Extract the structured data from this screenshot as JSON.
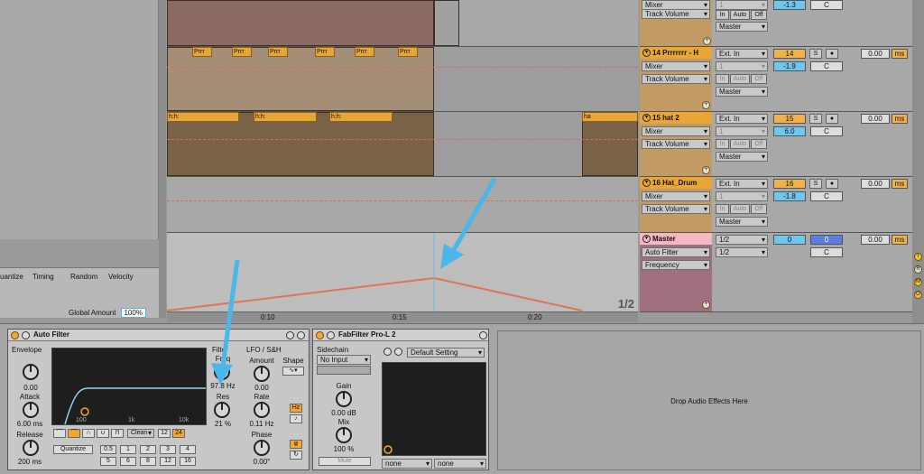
{
  "groove": {
    "headers": [
      "uantize",
      "Timing",
      "Random",
      "Velocity"
    ],
    "global_amount_label": "Global Amount",
    "global_amount_value": "100%"
  },
  "timeline": {
    "labels": [
      "0:10",
      "0:15",
      "0:20"
    ]
  },
  "arrangement": {
    "clip_label_prrr": "Prrr",
    "clip_label_hat": "h:h:",
    "clip_label_hat2": "ha",
    "master_time_sig": "1/2",
    "playhead_label": "1/2"
  },
  "tracks": [
    {
      "name": "14 Prrrrrrr - H",
      "input": "Ext. In",
      "mon": "Mixer",
      "auto": "Track Volume",
      "chan": "1",
      "dest": "Master",
      "num": "14",
      "vol": "-1.9",
      "pan": "C",
      "send": "0.00",
      "unit": "ms",
      "color": "#e7a636"
    },
    {
      "name": "15 hat 2",
      "input": "Ext. In",
      "mon": "Mixer",
      "auto": "Track Volume",
      "chan": "1",
      "dest": "Master",
      "num": "15",
      "vol": "6.0",
      "pan": "C",
      "send": "0.00",
      "unit": "ms",
      "color": "#e7a636"
    },
    {
      "name": "16 Hat_Drum",
      "input": "Ext. In",
      "mon": "Mixer",
      "auto": "Track Volume",
      "chan": "1",
      "dest": "Master",
      "num": "16",
      "vol": "-1.8",
      "pan": "C",
      "send": "0.00",
      "unit": "ms",
      "color": "#e7a636"
    }
  ],
  "top_track": {
    "mon": "Mixer",
    "auto": "Track Volume",
    "chan": "1",
    "dest": "Master",
    "vol": "-1.3",
    "pan": "C",
    "in": "In",
    "auto_btn": "Auto",
    "off": "Off"
  },
  "monitor_buttons": {
    "in": "In",
    "auto": "Auto",
    "off": "Off"
  },
  "solo_label": "S",
  "master": {
    "name": "Master",
    "input": "1/2",
    "device": "Auto Filter",
    "param": "Frequency",
    "output": "1/2",
    "vol": "0",
    "pan_num": "0",
    "pan": "C",
    "send": "0.00",
    "unit": "ms"
  },
  "side_letters": [
    "I",
    "R",
    "M",
    "O"
  ],
  "auto_filter": {
    "title": "Auto Filter",
    "envelope_label": "Envelope",
    "env_amount": "0.00",
    "attack_label": "Attack",
    "attack": "6.00 ms",
    "release_label": "Release",
    "release": "200 ms",
    "freq_axis": [
      "100",
      "1k",
      "10k"
    ],
    "filter_label": "Filter",
    "freq_label": "Freq",
    "freq": "97.8 Hz",
    "res_label": "Res",
    "res": "21 %",
    "circuit": "Clean",
    "slope_12": "12",
    "slope_24": "24",
    "quantize": "Quantize",
    "q_values": [
      "0.5",
      "1",
      "2",
      "3",
      "4",
      "5",
      "6",
      "8",
      "12",
      "16"
    ],
    "lfo_label": "LFO / S&H",
    "amount_label": "Amount",
    "amount": "0.00",
    "shape_label": "Shape",
    "rate_label": "Rate",
    "rate": "0.11 Hz",
    "hz_btn": "Hz",
    "phase_label": "Phase",
    "phase": "0.00°"
  },
  "pro_l": {
    "title": "FabFilter Pro-L 2",
    "sidechain_label": "Sidechain",
    "sidechain": "No Input",
    "preset": "Default Setting",
    "gain_label": "Gain",
    "gain": "0.00 dB",
    "mix_label": "Mix",
    "mix": "100 %",
    "mute": "Mute",
    "bottom_left": "none",
    "bottom_right": "none"
  },
  "drop_text": "Drop Audio Effects Here"
}
